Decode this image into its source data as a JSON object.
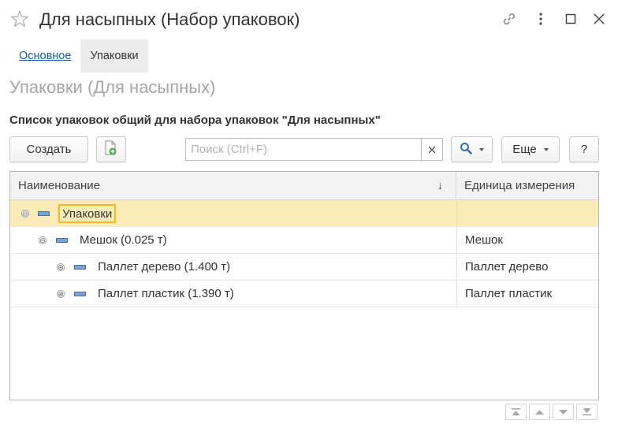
{
  "window": {
    "title": "Для насыпных (Набор упаковок)",
    "icons": {
      "favorite": "star-icon",
      "link": "link-icon",
      "more": "more-vertical-icon",
      "maximize": "maximize-icon",
      "close": "close-icon"
    }
  },
  "tabs": [
    {
      "label": "Основное",
      "active": false
    },
    {
      "label": "Упаковки",
      "active": true
    }
  ],
  "section_title": "Упаковки (Для насыпных)",
  "subheading": "Список упаковок общий для набора упаковок \"Для насыпных\"",
  "toolbar": {
    "create_label": "Создать",
    "add_icon": "add-document-icon",
    "search_placeholder": "Поиск (Ctrl+F)",
    "search_value": "",
    "clear_icon": "clear-icon",
    "search_icon": "search-icon",
    "more_label": "Еще",
    "help_label": "?"
  },
  "table": {
    "columns": [
      "Наименование",
      "Единица измерения"
    ],
    "sort_indicator": "↓",
    "rows": [
      {
        "name": "Упаковки",
        "unit": "",
        "level": 0,
        "toggle": "⊖",
        "selected": true
      },
      {
        "name": "Мешок (0.025 т)",
        "unit": "Мешок",
        "level": 1,
        "toggle": "⊖",
        "selected": false
      },
      {
        "name": "Паллет дерево (1.400 т)",
        "unit": "Паллет дерево",
        "level": 2,
        "toggle": "⊕",
        "selected": false
      },
      {
        "name": "Паллет пластик (1.390 т)",
        "unit": "Паллет пластик",
        "level": 2,
        "toggle": "⊕",
        "selected": false
      }
    ]
  },
  "pager_icons": [
    "first-page-icon",
    "page-up-icon",
    "page-down-icon",
    "last-page-icon"
  ],
  "colors": {
    "link": "#1c5ba8",
    "selection": "#fbecb7",
    "selection_border": "#f0b92a",
    "muted_title": "#a6a6a6",
    "package_icon": "#7aa3d4",
    "add_icon_green": "#4caf50",
    "search_icon_blue": "#2f6db5"
  }
}
